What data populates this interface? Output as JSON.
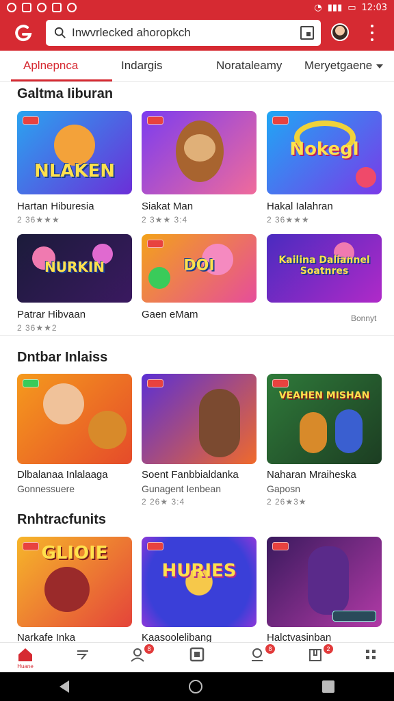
{
  "status_bar": {
    "time": "12:03"
  },
  "search": {
    "value": "Inwvrlecked ahoropkch"
  },
  "tabs": [
    {
      "label": "Aplnepnca",
      "active": true
    },
    {
      "label": "Indargis",
      "active": false
    },
    {
      "label": "Norataleamy",
      "active": false
    },
    {
      "label": "Meryetgaene",
      "active": false
    }
  ],
  "sections": [
    {
      "title": "Galtma Iiburan",
      "cards": [
        {
          "title": "Hartan Hiburesia",
          "meta": "2 36★★★",
          "thumb_text": "NLAKEN",
          "colors": [
            "#2aa4f0",
            "#6b2fd8"
          ]
        },
        {
          "title": "Siakat Man",
          "meta": "2 3★★ 3:4",
          "thumb_text": "",
          "colors": [
            "#7b3cf0",
            "#f06b9b"
          ]
        },
        {
          "title": "Hakal Ialahran",
          "meta": "2 36★★★",
          "thumb_text": "Nokegl",
          "colors": [
            "#1fa7f5",
            "#7a3ae8"
          ]
        },
        {
          "title": "Patrar Hibvaan",
          "meta": "2 36★★2",
          "thumb_text": "NURKIN",
          "colors": [
            "#1b1b3a",
            "#3a1960"
          ]
        },
        {
          "title": "Gaen eMam",
          "meta": "",
          "thumb_text": "DOI",
          "colors": [
            "#f3a21a",
            "#e64d9a"
          ]
        },
        {
          "title": "",
          "meta": "",
          "thumb_text": "Kailina Daliannel Soatnres",
          "colors": [
            "#4a2bbf",
            "#b02ac8"
          ]
        }
      ],
      "more_label": "Bonnyt"
    },
    {
      "title": "Dntbar Inlaiss",
      "cards": [
        {
          "title": "Dlbalanaa Inlalaaga",
          "sub": "Gonnessuere",
          "meta": "",
          "thumb_text": "",
          "colors": [
            "#f59a1d",
            "#e54b2a"
          ]
        },
        {
          "title": "Soent Fanbbialdanka",
          "sub": "Gunagent Ienbean",
          "meta": "2 26★ 3:4",
          "thumb_text": "",
          "colors": [
            "#5b2fd4",
            "#f06a2b"
          ]
        },
        {
          "title": "Naharan Mraiheska",
          "sub": "Gaposn",
          "meta": "2 26★3★",
          "thumb_text": "VEAHEN MISHAN",
          "colors": [
            "#2f7a3a",
            "#1c3d22"
          ]
        }
      ]
    },
    {
      "title": "Rnhtracfunits",
      "cards": [
        {
          "title": "Narkafe Inka",
          "meta": "",
          "thumb_text": "GLIOIE",
          "colors": [
            "#f6b62a",
            "#e4443a"
          ]
        },
        {
          "title": "Kaasoolelibang",
          "meta": "",
          "thumb_text": "HURIES",
          "colors": [
            "#3a3fd8",
            "#8e38d9"
          ]
        },
        {
          "title": "Halctvasinban",
          "meta": "",
          "thumb_text": "",
          "colors": [
            "#3a1a5e",
            "#b13aa6"
          ]
        }
      ]
    }
  ],
  "bottom_nav": [
    {
      "label": "Huane",
      "icon": "home-icon",
      "badge": ""
    },
    {
      "label": "",
      "icon": "compass-icon",
      "badge": ""
    },
    {
      "label": "",
      "icon": "people-icon",
      "badge": "8"
    },
    {
      "label": "",
      "icon": "wallet-icon",
      "badge": ""
    },
    {
      "label": "",
      "icon": "chat-icon",
      "badge": "8"
    },
    {
      "label": "",
      "icon": "bag-icon",
      "badge": "2"
    },
    {
      "label": "",
      "icon": "grid-icon",
      "badge": ""
    }
  ],
  "colors": {
    "brand": "#d62a32"
  }
}
